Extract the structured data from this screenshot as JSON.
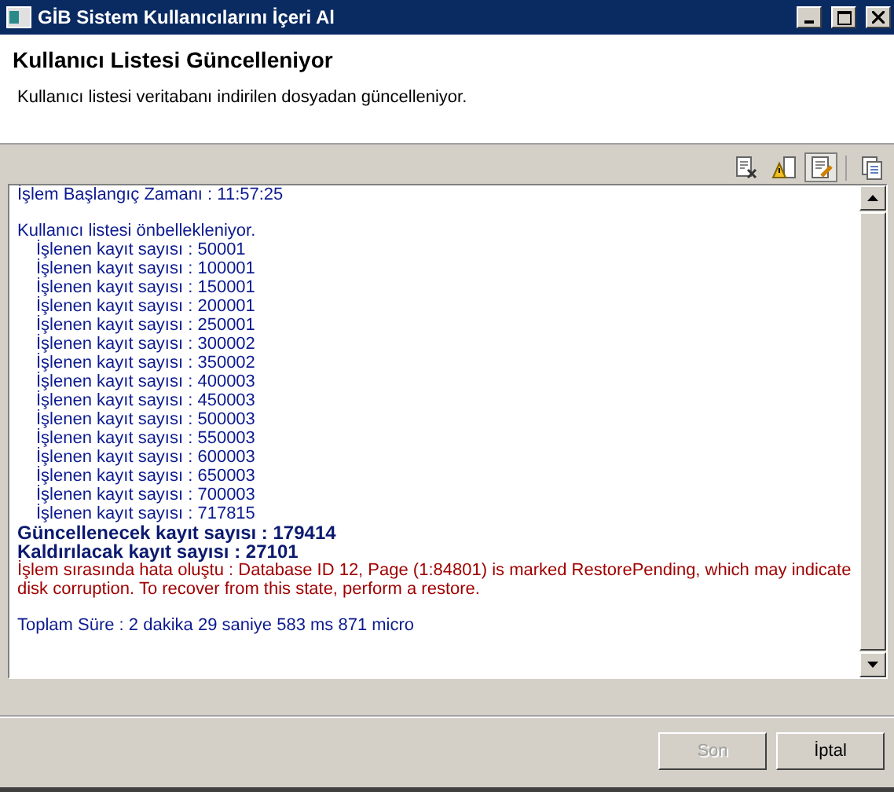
{
  "window": {
    "title": "GİB Sistem Kullanıcılarını İçeri Al"
  },
  "header": {
    "title": "Kullanıcı Listesi Güncelleniyor",
    "subtitle": "Kullanıcı listesi veritabanı indirilen dosyadan güncelleniyor."
  },
  "toolbar": [
    {
      "kind": "clear",
      "pressed": false
    },
    {
      "kind": "warning",
      "pressed": false
    },
    {
      "kind": "edit",
      "pressed": true
    },
    {
      "kind": "copy",
      "pressed": false
    }
  ],
  "log": [
    {
      "kind": "normal",
      "text": "İşlem Başlangıç Zamanı : 11:57:25"
    },
    {
      "kind": "gap"
    },
    {
      "kind": "normal",
      "text": "Kullanıcı listesi önbellekleniyor."
    },
    {
      "kind": "indent",
      "text": "İşlenen kayıt sayısı : 50001"
    },
    {
      "kind": "indent",
      "text": "İşlenen kayıt sayısı : 100001"
    },
    {
      "kind": "indent",
      "text": "İşlenen kayıt sayısı : 150001"
    },
    {
      "kind": "indent",
      "text": "İşlenen kayıt sayısı : 200001"
    },
    {
      "kind": "indent",
      "text": "İşlenen kayıt sayısı : 250001"
    },
    {
      "kind": "indent",
      "text": "İşlenen kayıt sayısı : 300002"
    },
    {
      "kind": "indent",
      "text": "İşlenen kayıt sayısı : 350002"
    },
    {
      "kind": "indent",
      "text": "İşlenen kayıt sayısı : 400003"
    },
    {
      "kind": "indent",
      "text": "İşlenen kayıt sayısı : 450003"
    },
    {
      "kind": "indent",
      "text": "İşlenen kayıt sayısı : 500003"
    },
    {
      "kind": "indent",
      "text": "İşlenen kayıt sayısı : 550003"
    },
    {
      "kind": "indent",
      "text": "İşlenen kayıt sayısı : 600003"
    },
    {
      "kind": "indent",
      "text": "İşlenen kayıt sayısı : 650003"
    },
    {
      "kind": "indent",
      "text": "İşlenen kayıt sayısı : 700003"
    },
    {
      "kind": "indent",
      "text": "İşlenen kayıt sayısı : 717815"
    },
    {
      "kind": "bold",
      "text": "Güncellenecek kayıt sayısı : 179414"
    },
    {
      "kind": "bold",
      "text": "Kaldırılacak kayıt sayısı : 27101"
    },
    {
      "kind": "error",
      "text": "İşlem sırasında hata oluştu : Database ID 12, Page (1:84801) is marked RestorePending, which may indicate disk corruption. To recover from this state, perform a restore."
    },
    {
      "kind": "gap"
    },
    {
      "kind": "normal",
      "text": "Toplam Süre : 2 dakika 29 saniye 583 ms 871 micro"
    }
  ],
  "buttons": [
    {
      "label": "Son",
      "disabled": true
    },
    {
      "label": "İptal",
      "disabled": false
    }
  ]
}
